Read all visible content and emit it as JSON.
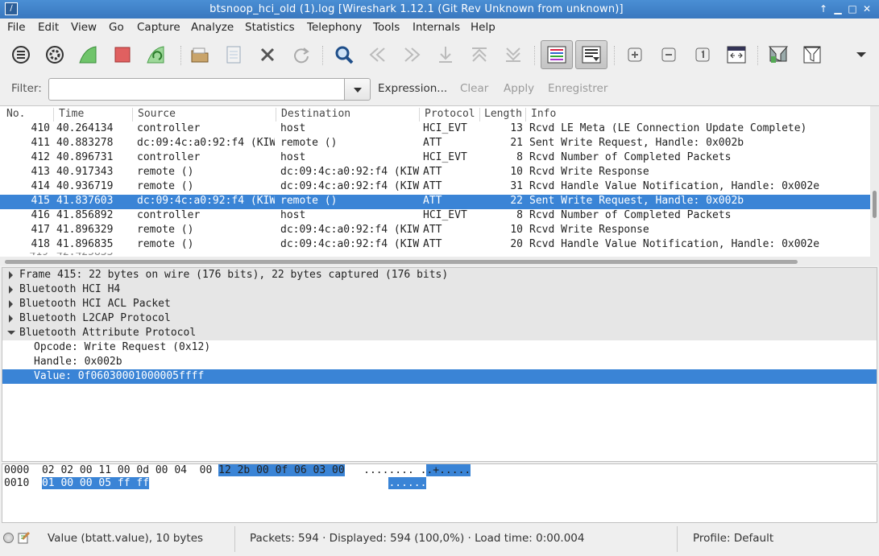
{
  "window": {
    "title": "btsnoop_hci_old (1).log  [Wireshark 1.12.1  (Git Rev Unknown from unknown)]",
    "controls": [
      "↑",
      "▁",
      "□",
      "✕"
    ]
  },
  "menu": [
    "File",
    "Edit",
    "View",
    "Go",
    "Capture",
    "Analyze",
    "Statistics",
    "Telephony",
    "Tools",
    "Internals",
    "Help"
  ],
  "toolbar": {
    "icons": [
      "interfaces-icon",
      "options-icon",
      "start-capture-icon",
      "stop-capture-icon",
      "restart-capture-icon",
      "open-file-icon",
      "save-file-icon",
      "close-file-icon",
      "reload-icon",
      "find-icon",
      "go-back-icon",
      "go-forward-icon",
      "go-to-packet-icon",
      "first-packet-icon",
      "last-packet-icon",
      "colorize-icon",
      "auto-scroll-icon",
      "zoom-in-icon",
      "zoom-out-icon",
      "normal-size-icon",
      "resize-columns-icon",
      "capture-filters-icon",
      "display-filters-icon",
      "more-icon"
    ]
  },
  "filter": {
    "label": "Filter:",
    "value": "",
    "placeholder": "",
    "expression": "Expression...",
    "clear": "Clear",
    "apply": "Apply",
    "save": "Enregistrer"
  },
  "packet_list": {
    "columns": [
      "No.",
      "Time",
      "Source",
      "Destination",
      "Protocol",
      "Length",
      "Info"
    ],
    "rows": [
      {
        "no": "410",
        "time": "40.264134",
        "src": "controller",
        "dst": "host",
        "proto": "HCI_EVT",
        "len": "13",
        "info": "Rcvd LE Meta (LE Connection Update Complete)"
      },
      {
        "no": "411",
        "time": "40.883278",
        "src": "dc:09:4c:a0:92:f4 (KIW",
        "dst": "remote ()",
        "proto": "ATT",
        "len": "21",
        "info": "Sent Write Request, Handle: 0x002b"
      },
      {
        "no": "412",
        "time": "40.896731",
        "src": "controller",
        "dst": "host",
        "proto": "HCI_EVT",
        "len": "8",
        "info": "Rcvd Number of Completed Packets"
      },
      {
        "no": "413",
        "time": "40.917343",
        "src": "remote ()",
        "dst": "dc:09:4c:a0:92:f4 (KIW",
        "proto": "ATT",
        "len": "10",
        "info": "Rcvd Write Response"
      },
      {
        "no": "414",
        "time": "40.936719",
        "src": "remote ()",
        "dst": "dc:09:4c:a0:92:f4 (KIW",
        "proto": "ATT",
        "len": "31",
        "info": "Rcvd Handle Value Notification, Handle: 0x002e"
      },
      {
        "no": "415",
        "time": "41.837603",
        "src": "dc:09:4c:a0:92:f4 (KIW",
        "dst": "remote ()",
        "proto": "ATT",
        "len": "22",
        "info": "Sent Write Request, Handle: 0x002b"
      },
      {
        "no": "416",
        "time": "41.856892",
        "src": "controller",
        "dst": "host",
        "proto": "HCI_EVT",
        "len": "8",
        "info": "Rcvd Number of Completed Packets"
      },
      {
        "no": "417",
        "time": "41.896329",
        "src": "remote ()",
        "dst": "dc:09:4c:a0:92:f4 (KIW",
        "proto": "ATT",
        "len": "10",
        "info": "Rcvd Write Response"
      },
      {
        "no": "418",
        "time": "41.896835",
        "src": "remote ()",
        "dst": "dc:09:4c:a0:92:f4 (KIW",
        "proto": "ATT",
        "len": "20",
        "info": "Rcvd Handle Value Notification, Handle: 0x002e"
      }
    ],
    "selected_index": 5,
    "selection_color": "#3a84d6"
  },
  "detail": {
    "rows": [
      {
        "text": "Frame 415: 22 bytes on wire (176 bits), 22 bytes captured (176 bits)",
        "expander": "collapsed",
        "indent": 0
      },
      {
        "text": "Bluetooth HCI H4",
        "expander": "collapsed",
        "indent": 0
      },
      {
        "text": "Bluetooth HCI ACL Packet",
        "expander": "collapsed",
        "indent": 0
      },
      {
        "text": "Bluetooth L2CAP Protocol",
        "expander": "collapsed",
        "indent": 0
      },
      {
        "text": "Bluetooth Attribute Protocol",
        "expander": "expanded",
        "indent": 0
      },
      {
        "text": "Opcode: Write Request (0x12)",
        "expander": "none",
        "indent": 1
      },
      {
        "text": "Handle: 0x002b",
        "expander": "none",
        "indent": 1
      },
      {
        "text": "Value: 0f06030001000005ffff",
        "expander": "none",
        "indent": 1
      }
    ],
    "selected_index": 7
  },
  "hex": {
    "lines": [
      {
        "offset": "0000",
        "bytes_plain": "02 02 00 11 00 0d 00 04  00 ",
        "bytes_sel": "12 2b 00 0f 06 03 00",
        "ascii_plain": "........ .",
        "ascii_sel": ".+....."
      },
      {
        "offset": "0010",
        "bytes_plain": "",
        "bytes_sel": "01 00 00 05 ff ff",
        "ascii_plain": "",
        "ascii_sel": "......"
      }
    ]
  },
  "status": {
    "field": "Value (btatt.value), 10 bytes",
    "packets": "Packets: 594 · Displayed: 594 (100,0%)  · Load time: 0:00.004",
    "profile": "Profile: Default"
  }
}
